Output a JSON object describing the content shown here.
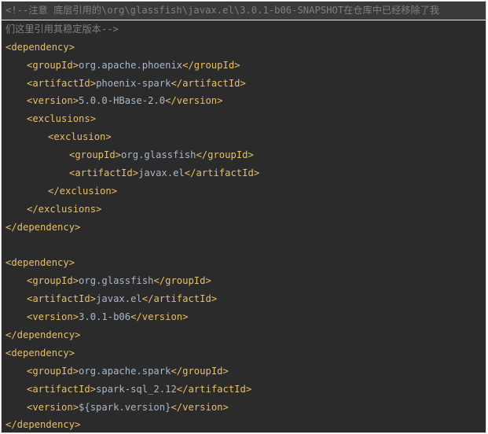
{
  "comment": {
    "line1": "<!--注意 底层引用的\\org\\glassfish\\javax.el\\3.0.1-b06-SNAPSHOT在仓库中已经移除了我",
    "line2": "们这里引用其稳定版本-->"
  },
  "dep1": {
    "open": "<dependency>",
    "groupId": {
      "open": "<groupId>",
      "value": "org.apache.phoenix",
      "close": "</groupId>"
    },
    "artifactId": {
      "open": "<artifactId>",
      "value": "phoenix-spark",
      "close": "</artifactId>"
    },
    "version": {
      "open": "<version>",
      "value": "5.0.0-HBase-2.0",
      "close": "</version>"
    },
    "exclusions_open": "<exclusions>",
    "exclusion_open": "<exclusion>",
    "excl_groupId": {
      "open": "<groupId>",
      "value": "org.glassfish",
      "close": "</groupId>"
    },
    "excl_artifactId": {
      "open": "<artifactId>",
      "value": "javax.el",
      "close": "</artifactId>"
    },
    "exclusion_close": "</exclusion>",
    "exclusions_close": "</exclusions>",
    "close": "</dependency>"
  },
  "dep2": {
    "open": "<dependency>",
    "groupId": {
      "open": "<groupId>",
      "value": "org.glassfish",
      "close": "</groupId>"
    },
    "artifactId": {
      "open": "<artifactId>",
      "value": "javax.el",
      "close": "</artifactId>"
    },
    "version": {
      "open": "<version>",
      "value": "3.0.1-b06",
      "close": "</version>"
    },
    "close": "</dependency>"
  },
  "dep3": {
    "open": "<dependency>",
    "groupId": {
      "open": "<groupId>",
      "value": "org.apache.spark",
      "close": "</groupId>"
    },
    "artifactId": {
      "open": "<artifactId>",
      "value": "spark-sql_2.12",
      "close": "</artifactId>"
    },
    "version": {
      "open": "<version>",
      "value": "${spark.version}",
      "close": "</version>"
    },
    "close": "</dependency>"
  },
  "colors": {
    "background": "#2b2b2b",
    "tag": "#e8bf6a",
    "text": "#a9b7c6",
    "comment": "#808080"
  }
}
